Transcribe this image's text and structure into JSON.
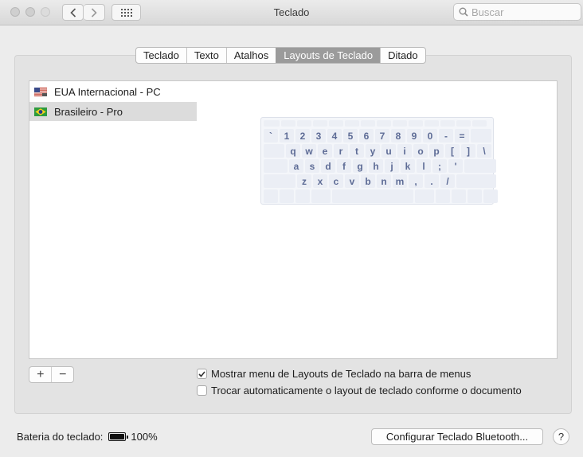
{
  "window": {
    "title": "Teclado",
    "search_placeholder": "Buscar"
  },
  "tabs": [
    {
      "label": "Teclado",
      "selected": false
    },
    {
      "label": "Texto",
      "selected": false
    },
    {
      "label": "Atalhos",
      "selected": false
    },
    {
      "label": "Layouts de Teclado",
      "selected": true
    },
    {
      "label": "Ditado",
      "selected": false
    }
  ],
  "layouts": [
    {
      "label": "EUA Internacional - PC",
      "flag": "us-flag-icon",
      "selected": false
    },
    {
      "label": "Brasileiro - Pro",
      "flag": "brazil-flag-icon",
      "selected": true
    }
  ],
  "keyboard_preview": {
    "row1": [
      "`",
      "1",
      "2",
      "3",
      "4",
      "5",
      "6",
      "7",
      "8",
      "9",
      "0",
      "-",
      "="
    ],
    "row2": [
      "q",
      "w",
      "e",
      "r",
      "t",
      "y",
      "u",
      "i",
      "o",
      "p",
      "[",
      "]",
      "\\"
    ],
    "row3": [
      "a",
      "s",
      "d",
      "f",
      "g",
      "h",
      "j",
      "k",
      "l",
      ";",
      "'"
    ],
    "row4": [
      "z",
      "x",
      "c",
      "v",
      "b",
      "n",
      "m",
      ",",
      ".",
      "/"
    ]
  },
  "controls": {
    "add_label": "+",
    "remove_label": "−"
  },
  "options": {
    "show_menu": {
      "label": "Mostrar menu de Layouts de Teclado na barra de menus",
      "checked": true
    },
    "auto_switch": {
      "label": "Trocar automaticamente o layout de teclado conforme o documento",
      "checked": false
    }
  },
  "footer": {
    "battery_label": "Bateria do teclado:",
    "battery_level": 1.0,
    "battery_percent": "100%",
    "bluetooth_button": "Configurar Teclado Bluetooth...",
    "help_label": "?"
  },
  "colors": {
    "selected_tab": "#9b9b9b",
    "selected_row": "#dcdcdc",
    "key_text": "#5e6c96",
    "key_background": "#ebeef5"
  }
}
